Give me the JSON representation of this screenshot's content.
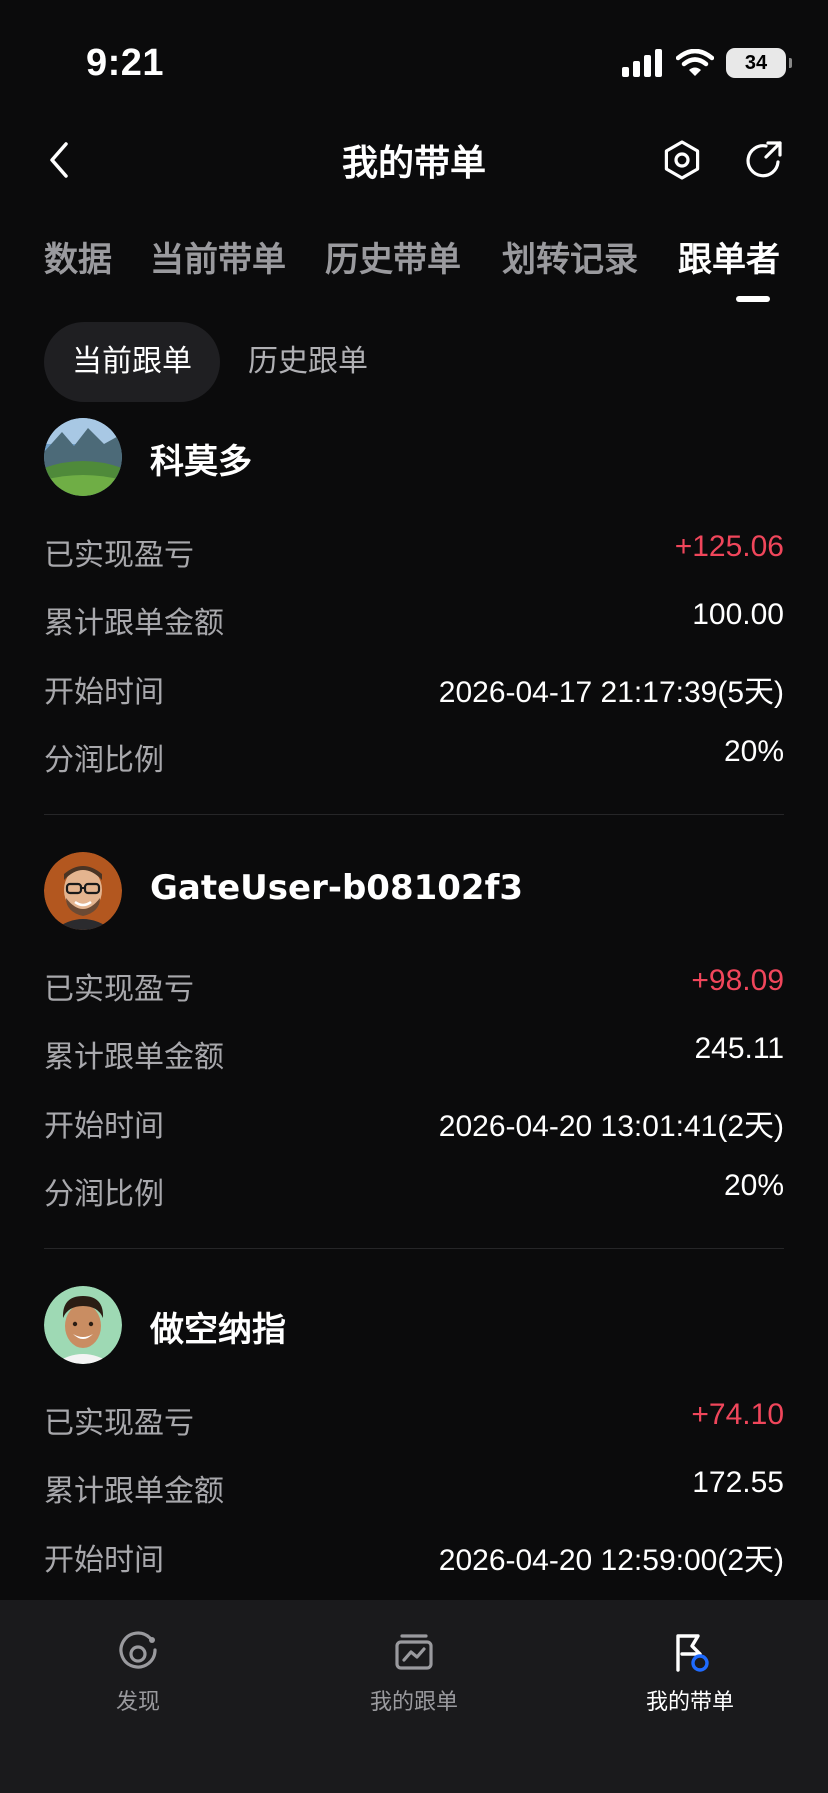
{
  "status": {
    "time": "9:21",
    "battery": "34"
  },
  "header": {
    "title": "我的带单"
  },
  "tabs": [
    {
      "label": "数据"
    },
    {
      "label": "当前带单"
    },
    {
      "label": "历史带单"
    },
    {
      "label": "划转记录"
    },
    {
      "label": "跟单者"
    }
  ],
  "subtabs": {
    "current": "当前跟单",
    "history": "历史跟单"
  },
  "followers": [
    {
      "name": "科莫多",
      "realized_pnl_label": "已实现盈亏",
      "realized_pnl": "+125.06",
      "total_amount_label": "累计跟单金额",
      "total_amount": "100.00",
      "start_label": "开始时间",
      "start_time": "2026-04-17 21:17:39(5天)",
      "share_label": "分润比例",
      "share_ratio": "20%"
    },
    {
      "name": "GateUser-b08102f3",
      "realized_pnl_label": "已实现盈亏",
      "realized_pnl": "+98.09",
      "total_amount_label": "累计跟单金额",
      "total_amount": "245.11",
      "start_label": "开始时间",
      "start_time": "2026-04-20 13:01:41(2天)",
      "share_label": "分润比例",
      "share_ratio": "20%"
    },
    {
      "name": "做空纳指",
      "realized_pnl_label": "已实现盈亏",
      "realized_pnl": "+74.10",
      "total_amount_label": "累计跟单金额",
      "total_amount": "172.55",
      "start_label": "开始时间",
      "start_time": "2026-04-20 12:59:00(2天)"
    }
  ],
  "bottom_nav": [
    {
      "label": "发现",
      "icon": "discover-icon"
    },
    {
      "label": "我的跟单",
      "icon": "copy-trade-icon"
    },
    {
      "label": "我的带单",
      "icon": "lead-trade-icon"
    }
  ],
  "colors": {
    "profit": "#f0465b",
    "background": "#0b0b0c",
    "active_badge": "#1f6bff"
  }
}
